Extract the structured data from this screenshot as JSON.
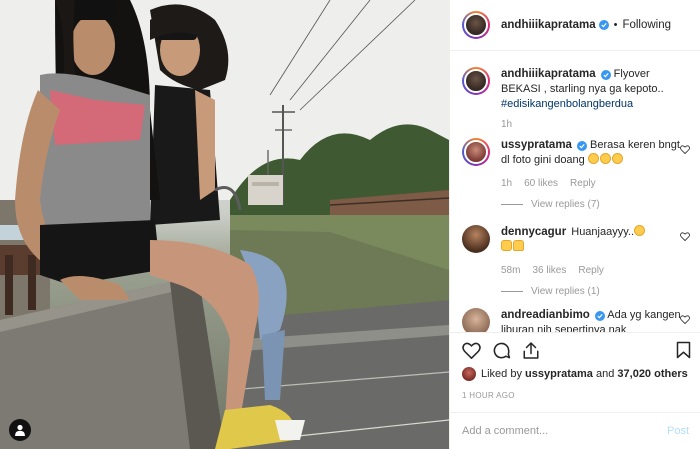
{
  "post": {
    "author": "andhiiikapratama",
    "follow_state": "Following",
    "separator": "•"
  },
  "caption": {
    "username": "andhiiikapratama",
    "text": "Flyover BEKASI , starling nya ga kepoto..",
    "hashtag": "#edisikangenbolangberdua",
    "time": "1h"
  },
  "comments": [
    {
      "username": "ussypratama",
      "verified": true,
      "text": "Berasa keren bngt dl foto gini doang",
      "emojis": [
        "grinning-sweat-emoji",
        "grinning-sweat-emoji",
        "grinning-sweat-emoji"
      ],
      "time": "1h",
      "likes": "60 likes",
      "reply_label": "Reply",
      "view_replies": "View replies (7)"
    },
    {
      "username": "dennycagur",
      "verified": false,
      "text": "Huanjaayyy..",
      "emojis": [
        "rofl-emoji",
        "clapping-hands-emoji",
        "thumbs-up-emoji"
      ],
      "time": "58m",
      "likes": "36 likes",
      "reply_label": "Reply",
      "view_replies": "View replies (1)"
    },
    {
      "username": "andreadianbimo",
      "verified": true,
      "text": "Ada yg kangen liburan nih sepertinya nak"
    }
  ],
  "likes": {
    "liked_by_prefix": "Liked by",
    "user": "ussypratama",
    "and": "and",
    "others": "37,020 others"
  },
  "timestamp": "1 HOUR AGO",
  "add_comment": {
    "placeholder": "Add a comment...",
    "post_label": "Post"
  },
  "icons": {
    "like": "heart-icon",
    "comment": "comment-bubble-icon",
    "share": "share-icon",
    "save": "bookmark-icon",
    "user_tags": "person-icon"
  },
  "colors": {
    "link_blue": "#003569",
    "verified_blue": "#3897f0",
    "muted": "#999999",
    "post_disabled": "#b2dffc"
  }
}
